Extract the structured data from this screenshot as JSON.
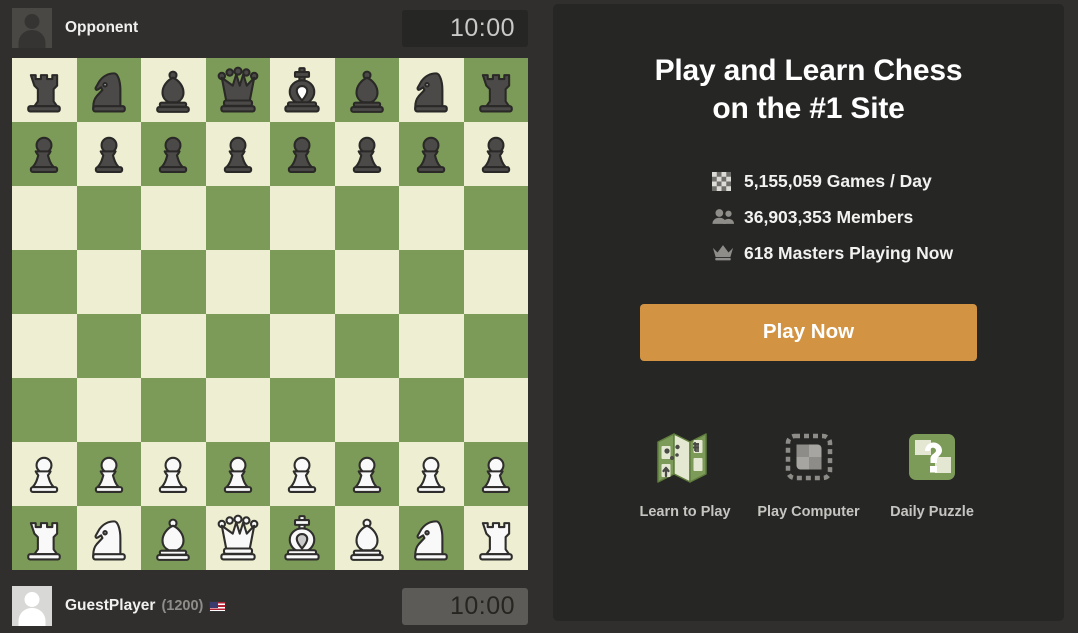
{
  "board": {
    "orientation": "white-bottom",
    "light_square_color": "#eeeed2",
    "dark_square_color": "#7d9b58",
    "position_fen": "rnbqkbnr/pppppppp/8/8/8/8/PPPPPPPP/RNBQKBNR",
    "ranks": [
      [
        "r",
        "n",
        "b",
        "q",
        "k",
        "b",
        "n",
        "r"
      ],
      [
        "p",
        "p",
        "p",
        "p",
        "p",
        "p",
        "p",
        "p"
      ],
      [
        "",
        "",
        "",
        "",
        "",
        "",
        "",
        ""
      ],
      [
        "",
        "",
        "",
        "",
        "",
        "",
        "",
        ""
      ],
      [
        "",
        "",
        "",
        "",
        "",
        "",
        "",
        ""
      ],
      [
        "",
        "",
        "",
        "",
        "",
        "",
        "",
        ""
      ],
      [
        "P",
        "P",
        "P",
        "P",
        "P",
        "P",
        "P",
        "P"
      ],
      [
        "R",
        "N",
        "B",
        "Q",
        "K",
        "B",
        "N",
        "R"
      ]
    ]
  },
  "opponent": {
    "name": "Opponent",
    "rating": "",
    "avatar_icon": "user-avatar-icon",
    "clock": "10:00",
    "clock_state": "idle"
  },
  "self": {
    "name": "GuestPlayer",
    "rating": "(1200)",
    "flag_icon": "us-flag-icon",
    "avatar_icon": "user-avatar-icon",
    "clock": "10:00",
    "clock_state": "active"
  },
  "promo": {
    "title_line1": "Play and Learn Chess",
    "title_line2": "on the #1 Site",
    "stats": [
      {
        "icon": "checkerboard-icon",
        "text": "5,155,059 Games / Day"
      },
      {
        "icon": "members-icon",
        "text": "36,903,353 Members"
      },
      {
        "icon": "crown-icon",
        "text": "618 Masters Playing Now"
      }
    ],
    "cta_label": "Play Now",
    "cta_color": "#d29343",
    "features": [
      {
        "icon": "map-icon",
        "label": "Learn to Play"
      },
      {
        "icon": "cpu-chip-icon",
        "label": "Play Computer"
      },
      {
        "icon": "puzzle-icon",
        "label": "Daily Puzzle"
      }
    ]
  },
  "colors": {
    "page_background": "#302f2d",
    "panel_background": "#262625",
    "accent_orange": "#d29343",
    "board_green": "#7d9b58",
    "board_cream": "#eeeed2"
  }
}
